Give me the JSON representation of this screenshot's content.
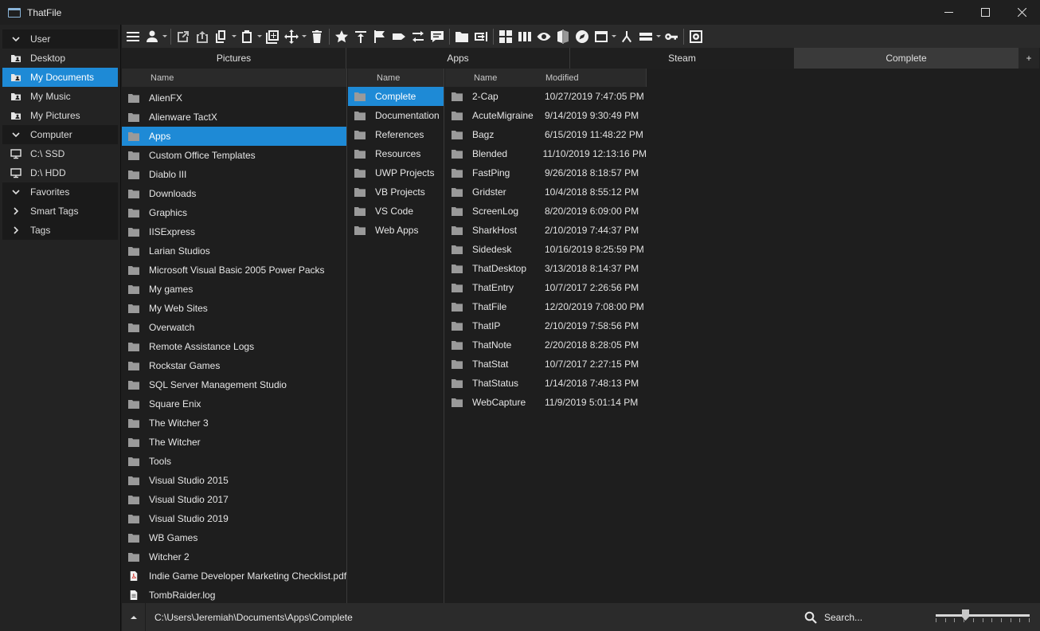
{
  "window": {
    "title": "ThatFile",
    "minimize_icon": "minimize-icon",
    "maximize_icon": "maximize-icon",
    "close_icon": "close-icon"
  },
  "sidebar": {
    "items": [
      {
        "label": "User",
        "icon": "chevron-down-icon",
        "type": "group",
        "selected": false
      },
      {
        "label": "Desktop",
        "icon": "user-folder-icon",
        "type": "item",
        "selected": false
      },
      {
        "label": "My Documents",
        "icon": "user-folder-icon",
        "type": "item",
        "selected": true
      },
      {
        "label": "My Music",
        "icon": "user-folder-icon",
        "type": "item",
        "selected": false
      },
      {
        "label": "My Pictures",
        "icon": "user-folder-icon",
        "type": "item",
        "selected": false
      },
      {
        "label": "Computer",
        "icon": "chevron-down-icon",
        "type": "group",
        "selected": false
      },
      {
        "label": "C:\\ SSD",
        "icon": "monitor-icon",
        "type": "item",
        "selected": false
      },
      {
        "label": "D:\\ HDD",
        "icon": "monitor-icon",
        "type": "item",
        "selected": false
      },
      {
        "label": "Favorites",
        "icon": "chevron-down-icon",
        "type": "group",
        "selected": false
      },
      {
        "label": "Smart Tags",
        "icon": "chevron-right-icon",
        "type": "group",
        "selected": false
      },
      {
        "label": "Tags",
        "icon": "chevron-right-icon",
        "type": "group",
        "selected": false
      }
    ]
  },
  "toolbar": {
    "buttons": [
      {
        "icon": "menu-icon"
      },
      {
        "icon": "user-icon",
        "dropdown": true
      },
      {
        "separator": true
      },
      {
        "icon": "open-external-icon"
      },
      {
        "icon": "open-icon"
      },
      {
        "icon": "copy-icon",
        "dropdown": true
      },
      {
        "icon": "paste-icon",
        "dropdown": true
      },
      {
        "icon": "add-icon"
      },
      {
        "icon": "move-icon",
        "dropdown": true
      },
      {
        "icon": "delete-icon"
      },
      {
        "separator": true
      },
      {
        "icon": "star-icon"
      },
      {
        "icon": "pin-top-icon"
      },
      {
        "icon": "flag-icon"
      },
      {
        "icon": "tag-icon"
      },
      {
        "icon": "swap-icon"
      },
      {
        "icon": "comment-icon"
      },
      {
        "separator": true
      },
      {
        "icon": "folder-icon"
      },
      {
        "icon": "rename-icon"
      },
      {
        "separator": true
      },
      {
        "icon": "tiles-view-icon"
      },
      {
        "icon": "columns-view-icon"
      },
      {
        "icon": "preview-eye-icon"
      },
      {
        "icon": "compare-icon"
      },
      {
        "icon": "compass-icon"
      },
      {
        "icon": "window-icon",
        "dropdown": true
      },
      {
        "icon": "merge-icon"
      },
      {
        "icon": "layout-rows-icon",
        "dropdown": true
      },
      {
        "icon": "key-icon"
      },
      {
        "separator": true
      },
      {
        "icon": "settings-gear-icon"
      }
    ]
  },
  "tabs": [
    {
      "label": "Pictures",
      "active": false
    },
    {
      "label": "Apps",
      "active": false
    },
    {
      "label": "Steam",
      "active": false
    },
    {
      "label": "Complete",
      "active": true
    }
  ],
  "tab_add_label": "+",
  "pane1": {
    "header": "Name",
    "selected_index": 2,
    "items": [
      {
        "name": "AlienFX",
        "icon": "folder-icon"
      },
      {
        "name": "Alienware TactX",
        "icon": "folder-icon"
      },
      {
        "name": "Apps",
        "icon": "folder-icon"
      },
      {
        "name": "Custom Office Templates",
        "icon": "folder-icon"
      },
      {
        "name": "Diablo III",
        "icon": "folder-icon"
      },
      {
        "name": "Downloads",
        "icon": "folder-icon"
      },
      {
        "name": "Graphics",
        "icon": "folder-icon"
      },
      {
        "name": "IISExpress",
        "icon": "folder-icon"
      },
      {
        "name": "Larian Studios",
        "icon": "folder-icon"
      },
      {
        "name": "Microsoft Visual Basic 2005 Power Packs",
        "icon": "folder-icon"
      },
      {
        "name": "My games",
        "icon": "folder-icon"
      },
      {
        "name": "My Web Sites",
        "icon": "folder-icon"
      },
      {
        "name": "Overwatch",
        "icon": "folder-icon"
      },
      {
        "name": "Remote Assistance Logs",
        "icon": "folder-icon"
      },
      {
        "name": "Rockstar Games",
        "icon": "folder-icon"
      },
      {
        "name": "SQL Server Management Studio",
        "icon": "folder-icon"
      },
      {
        "name": "Square Enix",
        "icon": "folder-icon"
      },
      {
        "name": "The Witcher 3",
        "icon": "folder-icon"
      },
      {
        "name": "The Witcher",
        "icon": "folder-icon"
      },
      {
        "name": "Tools",
        "icon": "folder-icon"
      },
      {
        "name": "Visual Studio 2015",
        "icon": "folder-icon"
      },
      {
        "name": "Visual Studio 2017",
        "icon": "folder-icon"
      },
      {
        "name": "Visual Studio 2019",
        "icon": "folder-icon"
      },
      {
        "name": "WB Games",
        "icon": "folder-icon"
      },
      {
        "name": "Witcher 2",
        "icon": "folder-icon"
      },
      {
        "name": "Indie Game Developer Marketing Checklist.pdf",
        "icon": "pdf-file-icon"
      },
      {
        "name": "TombRaider.log",
        "icon": "text-file-icon"
      }
    ]
  },
  "pane2": {
    "header": "Name",
    "selected_index": 0,
    "items": [
      {
        "name": "Complete"
      },
      {
        "name": "Documentation"
      },
      {
        "name": "References"
      },
      {
        "name": "Resources"
      },
      {
        "name": "UWP Projects"
      },
      {
        "name": "VB Projects"
      },
      {
        "name": "VS Code"
      },
      {
        "name": "Web Apps"
      }
    ]
  },
  "pane3": {
    "header_name": "Name",
    "header_modified": "Modified",
    "items": [
      {
        "name": "2-Cap",
        "modified": "10/27/2019 7:47:05 PM"
      },
      {
        "name": "AcuteMigraine",
        "modified": "9/14/2019 9:30:49 PM"
      },
      {
        "name": "Bagz",
        "modified": "6/15/2019 11:48:22 PM"
      },
      {
        "name": "Blended",
        "modified": "11/10/2019 12:13:16 PM"
      },
      {
        "name": "FastPing",
        "modified": "9/26/2018 8:18:57 PM"
      },
      {
        "name": "Gridster",
        "modified": "10/4/2018 8:55:12 PM"
      },
      {
        "name": "ScreenLog",
        "modified": "8/20/2019 6:09:00 PM"
      },
      {
        "name": "SharkHost",
        "modified": "2/10/2019 7:44:37 PM"
      },
      {
        "name": "Sidedesk",
        "modified": "10/16/2019 8:25:59 PM"
      },
      {
        "name": "ThatDesktop",
        "modified": "3/13/2018 8:14:37 PM"
      },
      {
        "name": "ThatEntry",
        "modified": "10/7/2017 2:26:56 PM"
      },
      {
        "name": "ThatFile",
        "modified": "12/20/2019 7:08:00 PM"
      },
      {
        "name": "ThatIP",
        "modified": "2/10/2019 7:58:56 PM"
      },
      {
        "name": "ThatNote",
        "modified": "2/20/2018 8:28:05 PM"
      },
      {
        "name": "ThatStat",
        "modified": "10/7/2017 2:27:15 PM"
      },
      {
        "name": "ThatStatus",
        "modified": "1/14/2018 7:48:13 PM"
      },
      {
        "name": "WebCapture",
        "modified": "11/9/2019 5:01:14 PM"
      }
    ]
  },
  "statusbar": {
    "up_icon": "chevron-up-icon",
    "path": "C:\\Users\\Jeremiah\\Documents\\Apps\\Complete",
    "search_placeholder": "Search...",
    "search_icon": "search-icon",
    "zoom_slider_fraction": 0.32,
    "zoom_slider_ticks": 11
  },
  "colors": {
    "accent": "#1e8ad6",
    "background": "#1e1e1e",
    "toolbar": "#2b2b2b",
    "folder": "#9a9a9a"
  }
}
